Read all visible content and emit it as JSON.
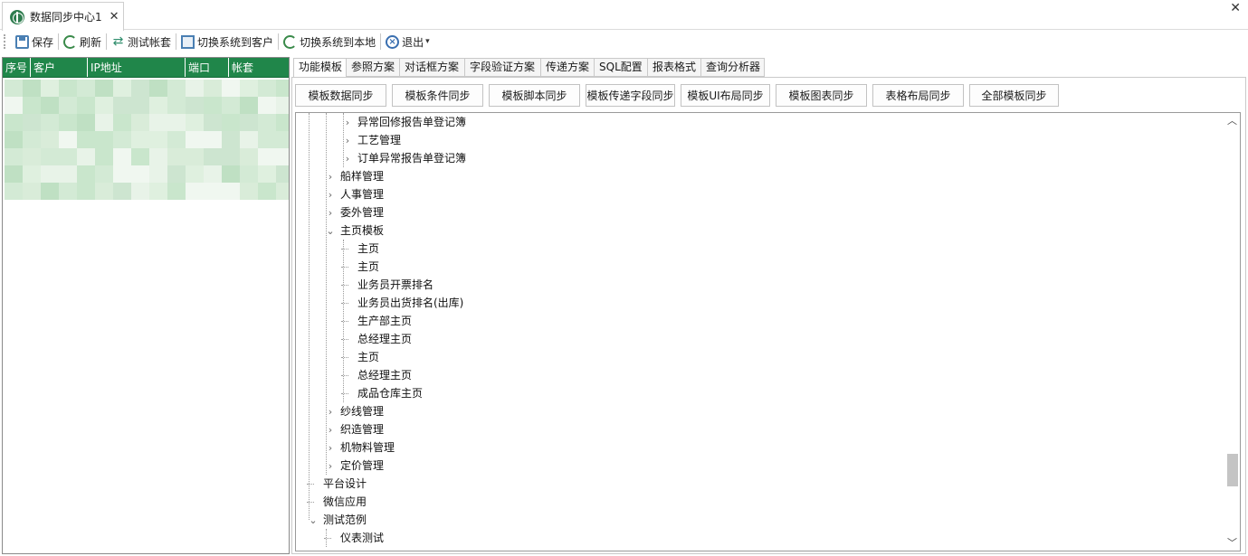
{
  "window": {
    "tab_title": "数据同步中心1",
    "tab_close": "✕",
    "close_glyph": "✕"
  },
  "toolbar": {
    "save": "保存",
    "refresh": "刷新",
    "test_account": "测试帐套",
    "switch_to_client": "切换系统到客户",
    "switch_to_local": "切换系统到本地",
    "exit": "退出",
    "more": "▾"
  },
  "grid": {
    "columns": [
      "序号",
      "客户",
      "IP地址",
      "端口",
      "帐套"
    ]
  },
  "tabs": [
    "功能模板",
    "参照方案",
    "对话框方案",
    "字段验证方案",
    "传递方案",
    "SQL配置",
    "报表格式",
    "查询分析器"
  ],
  "active_tab": 0,
  "sync_buttons": [
    "模板数据同步",
    "模板条件同步",
    "模板脚本同步",
    "模板传递字段同步",
    "模板UI布局同步",
    "模板图表同步",
    "表格布局同步",
    "全部模板同步"
  ],
  "tree": {
    "nodes": [
      {
        "label": "异常回修报告单登记簿",
        "level": 3,
        "state": "collapsed"
      },
      {
        "label": "工艺管理",
        "level": 3,
        "state": "collapsed"
      },
      {
        "label": "订单异常报告单登记簿",
        "level": 3,
        "state": "collapsed"
      },
      {
        "label": "船样管理",
        "level": 2,
        "state": "collapsed"
      },
      {
        "label": "人事管理",
        "level": 2,
        "state": "collapsed"
      },
      {
        "label": "委外管理",
        "level": 2,
        "state": "collapsed"
      },
      {
        "label": "主页模板",
        "level": 2,
        "state": "expanded"
      },
      {
        "label": "主页",
        "level": 3,
        "state": "leaf"
      },
      {
        "label": "主页",
        "level": 3,
        "state": "leaf"
      },
      {
        "label": "业务员开票排名",
        "level": 3,
        "state": "leaf"
      },
      {
        "label": "业务员出货排名(出库)",
        "level": 3,
        "state": "leaf"
      },
      {
        "label": "生产部主页",
        "level": 3,
        "state": "leaf"
      },
      {
        "label": "总经理主页",
        "level": 3,
        "state": "leaf"
      },
      {
        "label": "主页",
        "level": 3,
        "state": "leaf"
      },
      {
        "label": "总经理主页",
        "level": 3,
        "state": "leaf"
      },
      {
        "label": "成品仓库主页",
        "level": 3,
        "state": "leaf"
      },
      {
        "label": "纱线管理",
        "level": 2,
        "state": "collapsed"
      },
      {
        "label": "织造管理",
        "level": 2,
        "state": "collapsed"
      },
      {
        "label": "机物料管理",
        "level": 2,
        "state": "collapsed"
      },
      {
        "label": "定价管理",
        "level": 2,
        "state": "collapsed"
      },
      {
        "label": "平台设计",
        "level": 1,
        "state": "leaf"
      },
      {
        "label": "微信应用",
        "level": 1,
        "state": "leaf"
      },
      {
        "label": "测试范例",
        "level": 1,
        "state": "expanded"
      },
      {
        "label": "仪表测试",
        "level": 2,
        "state": "leaf"
      }
    ]
  },
  "scrollbar": {
    "up": "︿",
    "down": "﹀",
    "position": 0.87
  },
  "colors": {
    "grid_header": "#20864a",
    "accent": "#2f7d4f"
  }
}
